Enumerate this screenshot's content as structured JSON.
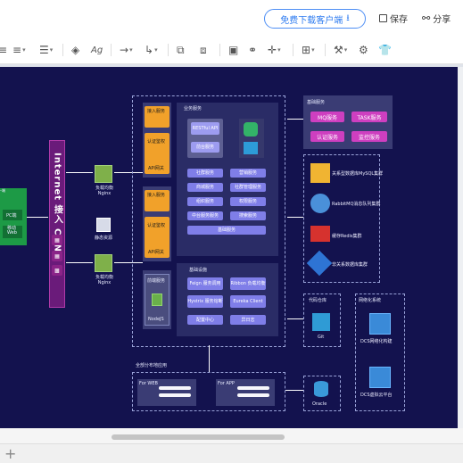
{
  "header": {
    "download_label": "免费下载客户端",
    "save_label": "保存",
    "share_label": "分享"
  },
  "toolbar": {
    "icons": [
      "align-icon",
      "list-icon",
      "fill-icon",
      "line-icon",
      "connector-icon",
      "elbow-icon",
      "front-icon",
      "back-icon",
      "image-icon",
      "link-icon",
      "insert-icon",
      "table-icon",
      "format-icon",
      "theme-icon"
    ]
  },
  "diagram": {
    "cdn_label": "Internet 接入 CDN",
    "pc_label": "PC端",
    "mobile_label": "移动 Web",
    "lb1_label": "负载均衡 Nginx",
    "lb2_label": "负载均衡 Nginx",
    "static_label": "静态资源",
    "svc1": {
      "head": "接入服务",
      "auth": "认证鉴权",
      "api": "API网关"
    },
    "svc2": {
      "head": "接入服务",
      "auth": "认证鉴权",
      "api": "API网关"
    },
    "svc3": {
      "head": "前端服务",
      "node": "NodeJS"
    },
    "business": {
      "title": "业务服务",
      "restful": "RESTful API",
      "frontend": "前台服务",
      "items": [
        "社群服务",
        "营销服务",
        "商城服务",
        "社群管理服务",
        "组织服务",
        "权限服务",
        "中台服务服务",
        "搜索服务",
        "基础服务"
      ]
    },
    "foundation": {
      "title": "基础设施",
      "items": [
        "Feign 服务调用",
        "Ribbon 负载均衡",
        "Hystrix 服务熔断",
        "Eureka Client",
        "配置中心",
        "异日志"
      ]
    },
    "basic_services": {
      "title": "基础服务",
      "items": [
        "MQ服务",
        "TASK服务",
        "认证服务",
        "监控服务"
      ]
    },
    "middleware": {
      "items": [
        "关系型数据库MySQL集群",
        "RabbitMQ消息队列集群",
        "缓存Redis集群",
        "非关系数据库集群"
      ]
    },
    "code_repo": {
      "title": "代码仓库",
      "label": "Git"
    },
    "cloud": {
      "title": "网络化系统",
      "items": [
        "DCS网络化构建",
        "DCS虚拟云平台"
      ]
    },
    "cluster": {
      "title": "全部分布地应用",
      "web": "For WEB",
      "app": "For APP"
    },
    "oracle_label": "Oracle"
  },
  "colors": {
    "background": "#13124e",
    "orange": "#f1a12a",
    "purple": "#7f7ee8",
    "magenta": "#ce3fc0",
    "green": "#1d9a46",
    "accent_blue": "#2f7cf0"
  }
}
